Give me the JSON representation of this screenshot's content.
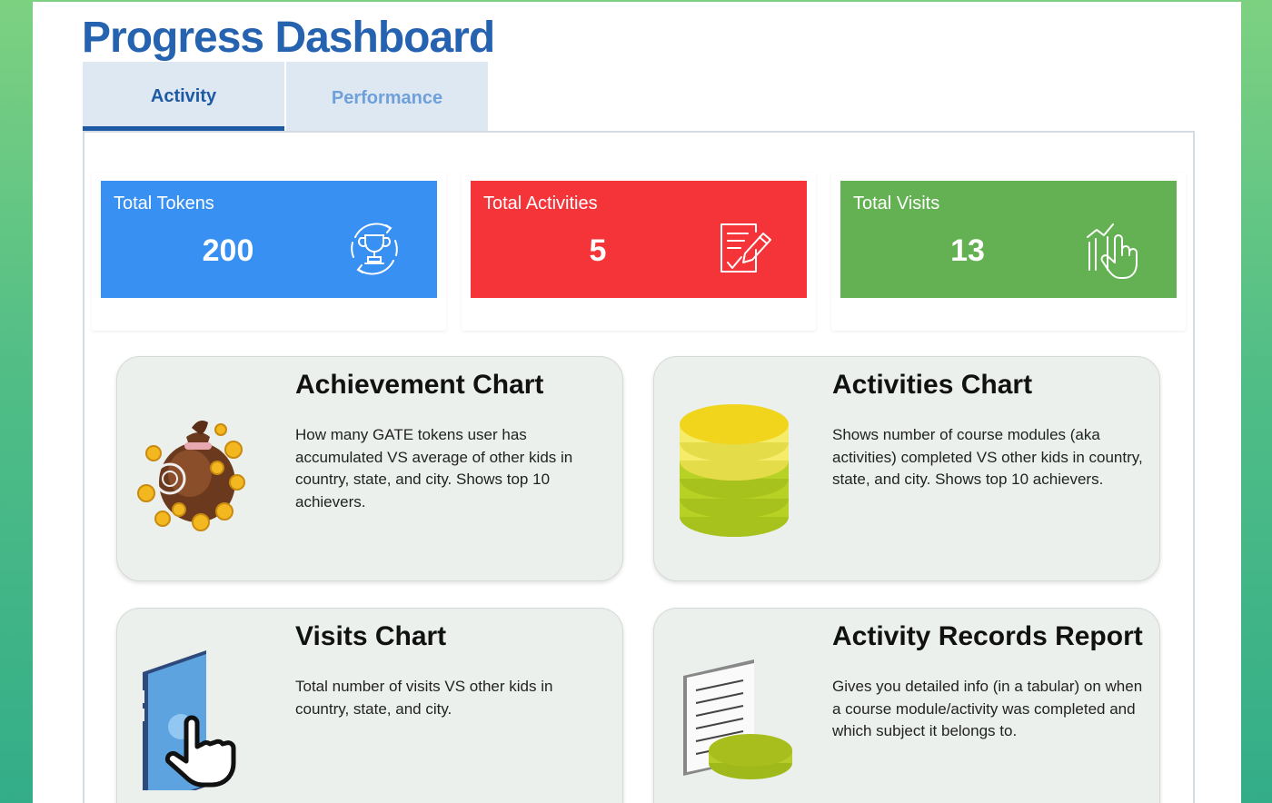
{
  "page_title": "Progress Dashboard",
  "tabs": [
    {
      "label": "Activity",
      "active": true
    },
    {
      "label": "Performance",
      "active": false
    }
  ],
  "stats": [
    {
      "label": "Total Tokens",
      "value": "200",
      "color": "#3790f2",
      "icon": "trophy-icon"
    },
    {
      "label": "Total Activities",
      "value": "5",
      "color": "#f5343a",
      "icon": "checklist-pencil-icon"
    },
    {
      "label": "Total Visits",
      "value": "13",
      "color": "#63b152",
      "icon": "tap-hand-icon"
    }
  ],
  "cards": [
    {
      "title": "Achievement Chart",
      "description": "How many GATE tokens user has accumulated VS average of other kids in country, state, and city. Shows top 10 achievers.",
      "icon": "money-bag-icon"
    },
    {
      "title": "Activities Chart",
      "description": "Shows number of course modules (aka activities) completed VS other kids in country, state, and city. Shows top 10 achievers.",
      "icon": "coin-stack-icon"
    },
    {
      "title": "Visits Chart",
      "description": "Total number of visits VS other kids in country, state, and city.",
      "icon": "phone-tap-icon"
    },
    {
      "title": "Activity Records Report",
      "description": "Gives you detailed info (in a tabular) on when a course module/activity was completed and which subject it belongs to.",
      "icon": "document-coin-icon"
    }
  ]
}
